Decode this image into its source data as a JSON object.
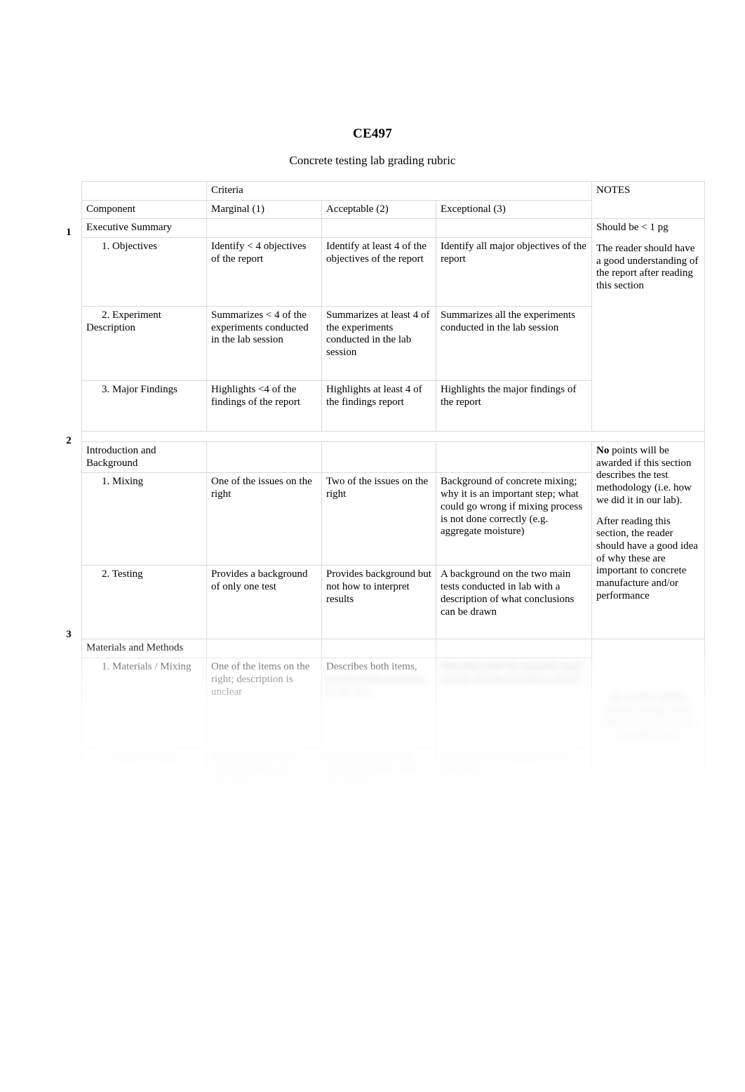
{
  "document": {
    "title": "CE497",
    "subtitle": "Concrete testing lab grading rubric"
  },
  "table": {
    "headers": {
      "component": "Component",
      "criteria": "Criteria",
      "notes": "NOTES",
      "marginal": "Marginal (1)",
      "acceptable": "Acceptable (2)",
      "exceptional": "Exceptional (3)"
    },
    "sections": [
      {
        "number": "1",
        "title": "Executive Summary",
        "notes": [
          "Should be < 1 pg",
          "The reader should have a good understanding of the report after reading this section"
        ],
        "rows": [
          {
            "component": "1. Objectives",
            "marginal": "Identify < 4 objectives of the report",
            "acceptable": "Identify at least 4 of the objectives of the report",
            "exceptional": "Identify all major objectives of the report"
          },
          {
            "component": "2. Experiment Description",
            "marginal": "Summarizes < 4 of the experiments conducted in the lab session",
            "acceptable": "Summarizes at least 4 of the experiments conducted in the lab session",
            "exceptional": "Summarizes all the experiments conducted in the lab session"
          },
          {
            "component": "3. Major Findings",
            "marginal": "Highlights <4 of the findings of the report",
            "acceptable": "Highlights at least 4 of the findings report",
            "exceptional": "Highlights the major findings of the report"
          }
        ]
      },
      {
        "number": "2",
        "title": "Introduction and Background",
        "notes_rich": [
          {
            "bold_lead": "No",
            "text": " points will be awarded if this section describes the test methodology (i.e. how we did it in our lab)."
          },
          {
            "bold_lead": "",
            "text": "After reading this section, the reader should have a good idea of why these are important to concrete manufacture and/or performance"
          }
        ],
        "rows": [
          {
            "component": "1. Mixing",
            "marginal": "One of the issues on the right",
            "acceptable": "Two of the issues on the right",
            "exceptional": "Background of concrete mixing; why it is an important step; what could go wrong if mixing process is not done correctly (e.g. aggregate moisture)"
          },
          {
            "component": "2. Testing",
            "marginal": "Provides a background of only one test",
            "acceptable": "Provides background but not how to interpret results",
            "exceptional": "A background on the two main tests conducted in lab with a description of what conclusions can be drawn"
          }
        ]
      },
      {
        "number": "3",
        "title": "Materials and Methods",
        "notes": [],
        "rows": [
          {
            "component": "1. Materials / Mixing",
            "marginal": "One of the items on the right; description is unclear",
            "acceptable": "Describes both items,",
            "exceptional": ""
          },
          {
            "component": "",
            "marginal": "",
            "acceptable": "",
            "exceptional": ""
          }
        ]
      }
    ]
  }
}
